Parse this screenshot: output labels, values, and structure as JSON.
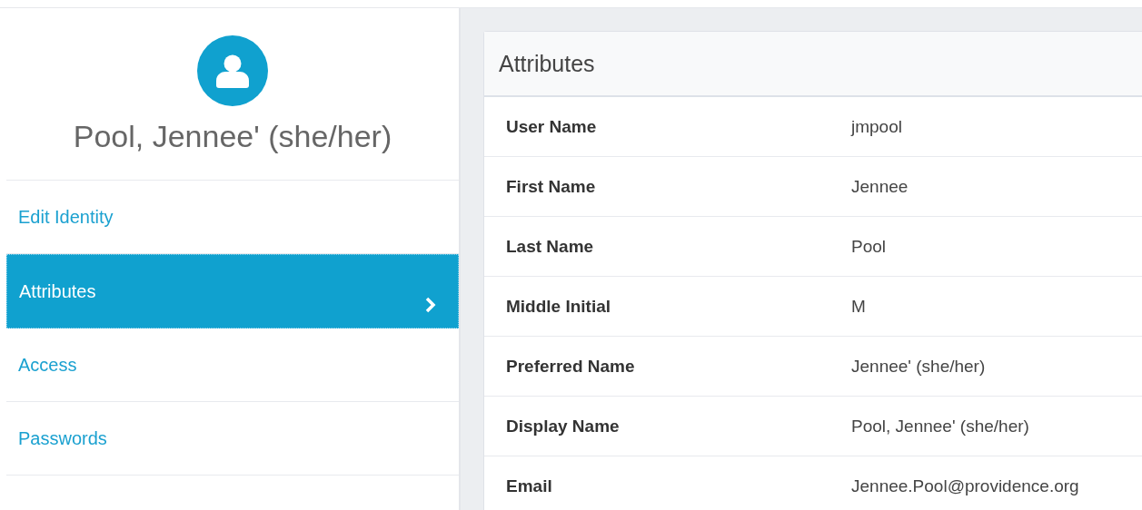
{
  "profile": {
    "name": "Pool, Jennee' (she/her)"
  },
  "sidebar": {
    "items": [
      {
        "label": "Edit Identity",
        "selected": false
      },
      {
        "label": "Attributes",
        "selected": true
      },
      {
        "label": "Access",
        "selected": false
      },
      {
        "label": "Passwords",
        "selected": false
      }
    ]
  },
  "panel": {
    "title": "Attributes",
    "rows": [
      {
        "label": "User Name",
        "value": "jmpool"
      },
      {
        "label": "First Name",
        "value": "Jennee"
      },
      {
        "label": "Last Name",
        "value": "Pool"
      },
      {
        "label": "Middle Initial",
        "value": "M"
      },
      {
        "label": "Preferred Name",
        "value": "Jennee' (she/her)"
      },
      {
        "label": "Display Name",
        "value": "Pool, Jennee' (she/her)"
      },
      {
        "label": "Email",
        "value": "Jennee.Pool@providence.org"
      }
    ]
  }
}
